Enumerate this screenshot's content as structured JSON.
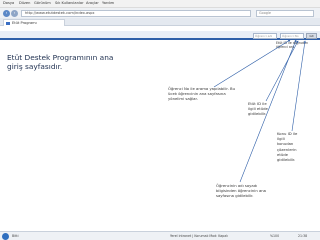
{
  "browser": {
    "menu": [
      "Dosya",
      "Düzen",
      "Görünüm",
      "Sık Kullanılanlar",
      "Araçlar",
      "Yardım"
    ],
    "url": "http://www.etutdestek.com/index.aspx",
    "search_placeholder": "Google",
    "tab_title": "Etüt Programı"
  },
  "header": {
    "input1_placeholder": "Öğrenci adı",
    "input2_placeholder": "Öğrenci No",
    "go_label": "Git",
    "popup_text": "Etüt ID ile doğrudan öğrenci ara"
  },
  "page": {
    "title": "Etüt Destek Programının ana giriş sayfasıdır."
  },
  "notes": {
    "n1": "Öğrenci No ile arama yapılabilir. Bu \nücek öğrencinin ana sayfasına \nyönelimi sağlar.",
    "n2": "Etüt ID ile \nilgili etüde \ngidilebilir.",
    "n3": "Konu ID ile \nilgili \nkonudan \nçözenlerin \netüde \ngidilebilir.",
    "n4": "Öğrencinin adı soyadı \nbilgisinden öğrencinin ana \nsayfasına gidilebilir."
  },
  "status": {
    "left": "Bitti",
    "zone": "Yerel intranet | Korumalı Mod: Kapalı",
    "zoom": "%100",
    "time": "21:38"
  }
}
